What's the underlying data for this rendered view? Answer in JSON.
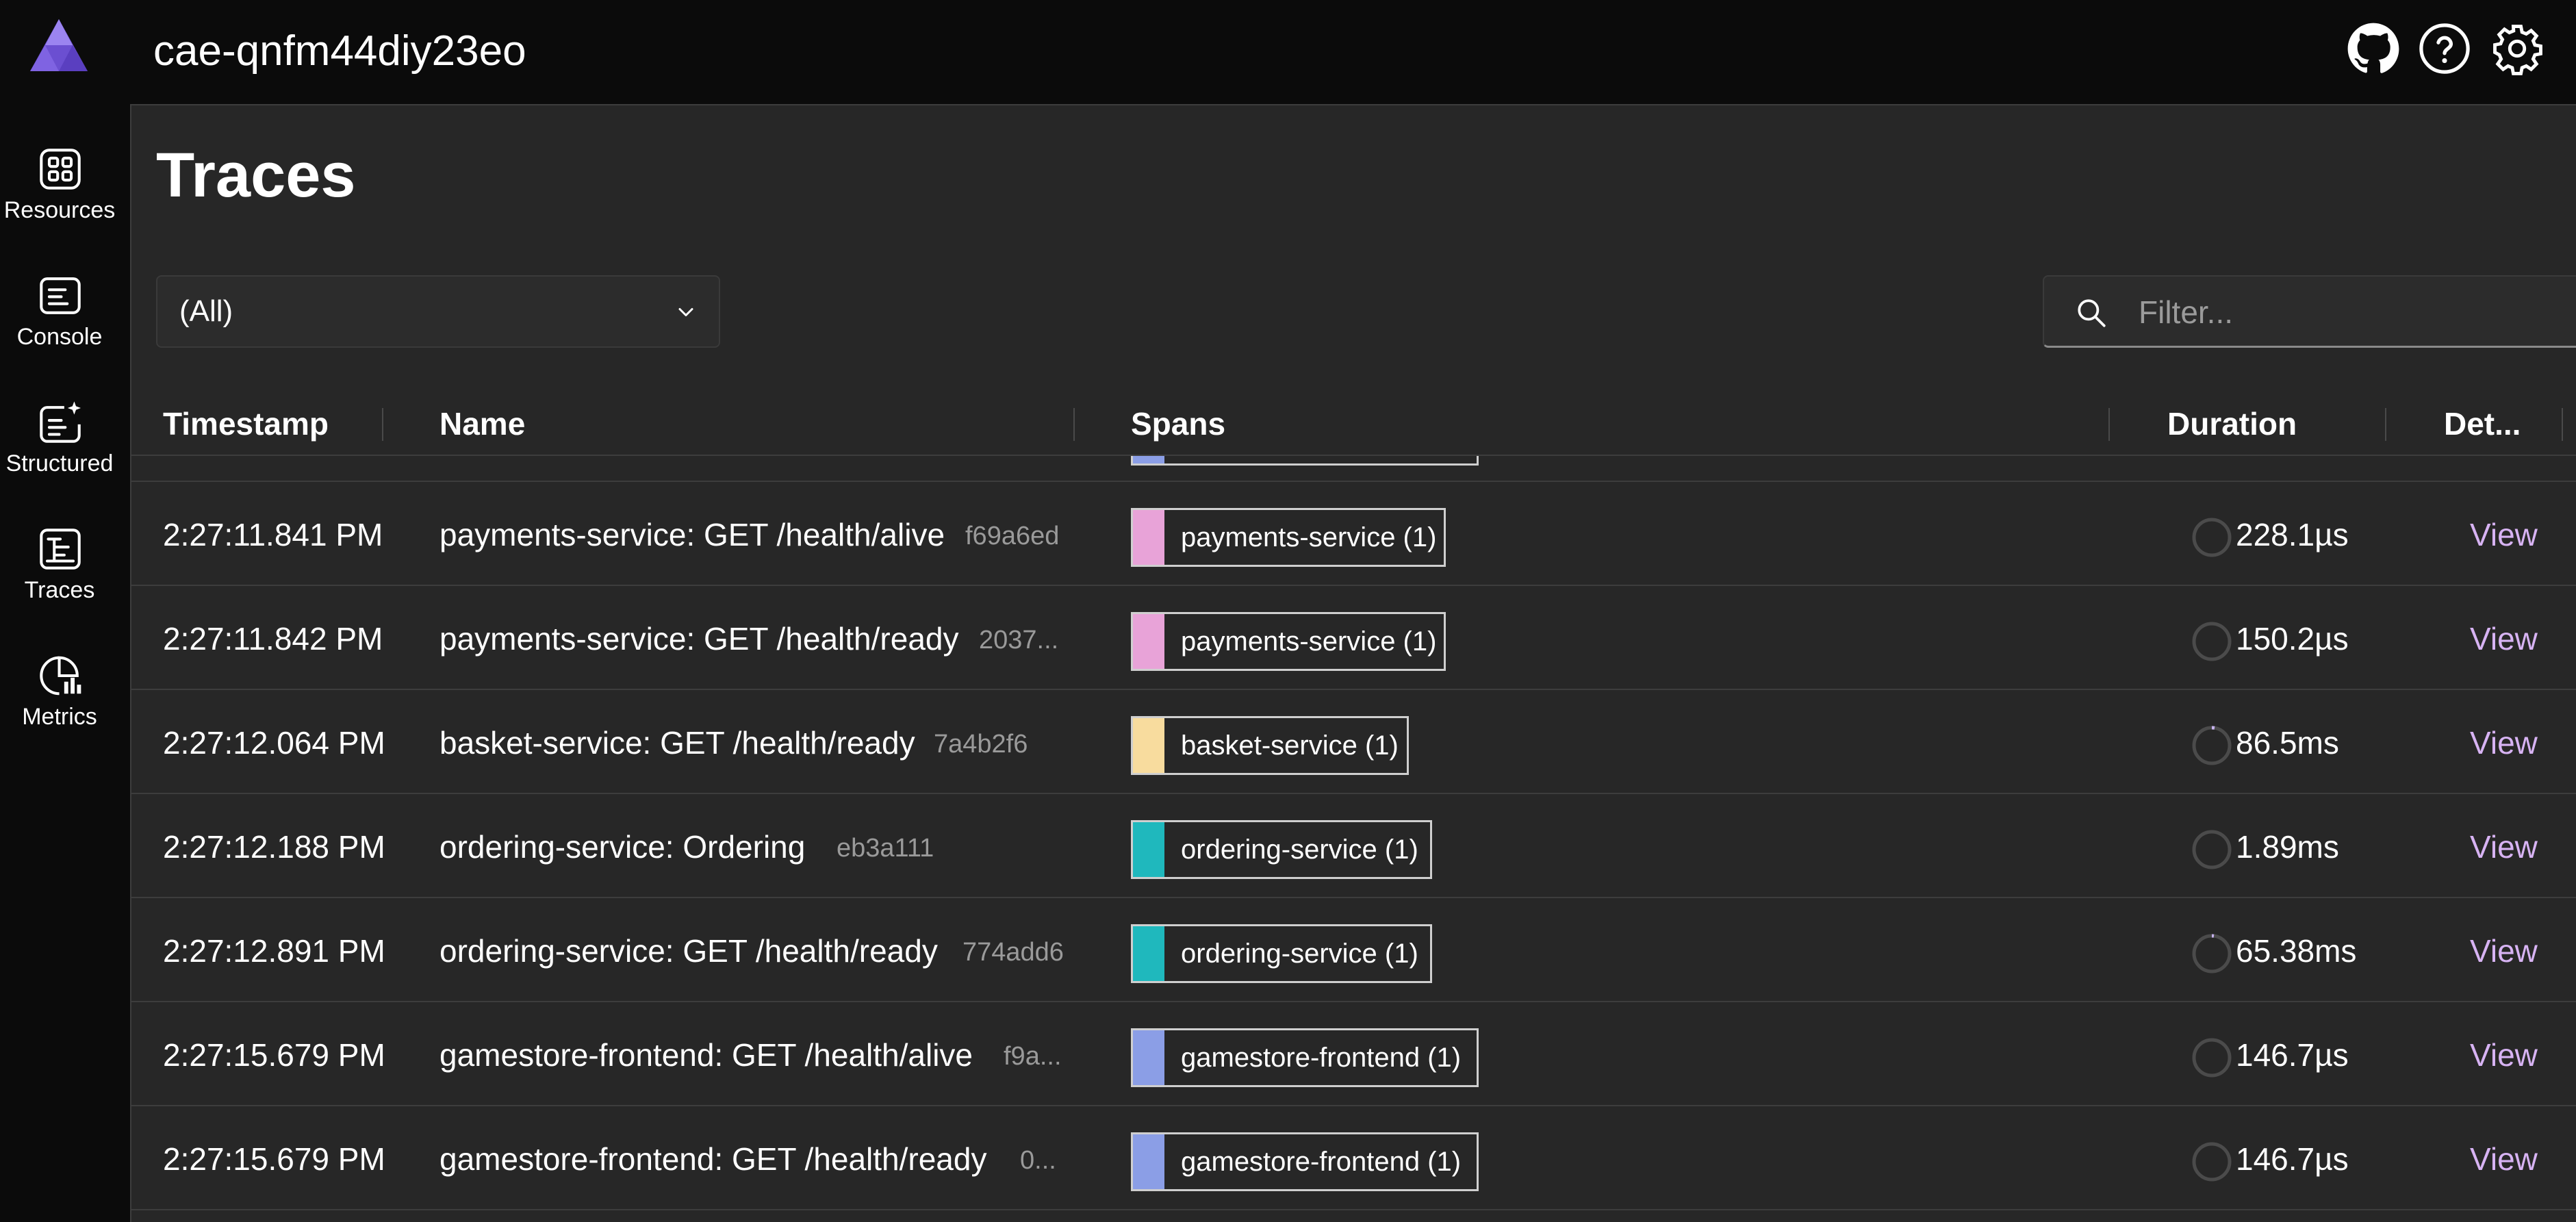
{
  "app": {
    "title": "cae-qnfm44diy23eo"
  },
  "topbar": {
    "icons": [
      "github-icon",
      "help-icon",
      "settings-icon"
    ]
  },
  "nav": {
    "items": [
      {
        "label": "Resources",
        "icon": "resources-grid-icon"
      },
      {
        "label": "Console",
        "icon": "console-icon"
      },
      {
        "label": "Structured",
        "icon": "structured-logs-icon"
      },
      {
        "label": "Traces",
        "icon": "traces-icon"
      },
      {
        "label": "Metrics",
        "icon": "metrics-icon"
      }
    ]
  },
  "page": {
    "title": "Traces"
  },
  "resource_select": {
    "value": "(All)"
  },
  "filter": {
    "placeholder": "Filter..."
  },
  "table": {
    "headers": {
      "timestamp": "Timestamp",
      "name": "Name",
      "spans": "Spans",
      "duration": "Duration",
      "details": "Det..."
    },
    "rows": [
      {
        "timestamp": "2:27:11.841 PM",
        "name": "payments-service: GET /health/alive",
        "trace_id": "f69a6ed",
        "span": "payments-service (1)",
        "color": "#e8a3d8",
        "duration": "228.1µs",
        "view": "View"
      },
      {
        "timestamp": "2:27:11.842 PM",
        "name": "payments-service: GET /health/ready",
        "trace_id": "2037...",
        "span": "payments-service (1)",
        "color": "#e8a3d8",
        "duration": "150.2µs",
        "view": "View"
      },
      {
        "timestamp": "2:27:12.064 PM",
        "name": "basket-service: GET /health/ready",
        "trace_id": "7a4b2f6",
        "span": "basket-service (1)",
        "color": "#f8dc9e",
        "duration": "86.5ms",
        "view": "View"
      },
      {
        "timestamp": "2:27:12.188 PM",
        "name": "ordering-service: Ordering",
        "trace_id": "eb3a111",
        "span": "ordering-service (1)",
        "color": "#1fb8bd",
        "duration": "1.89ms",
        "view": "View"
      },
      {
        "timestamp": "2:27:12.891 PM",
        "name": "ordering-service: GET /health/ready",
        "trace_id": "774add6",
        "span": "ordering-service (1)",
        "color": "#1fb8bd",
        "duration": "65.38ms",
        "view": "View"
      },
      {
        "timestamp": "2:27:15.679 PM",
        "name": "gamestore-frontend: GET /health/alive",
        "trace_id": "f9a...",
        "span": "gamestore-frontend (1)",
        "color": "#8b9ee6",
        "duration": "146.7µs",
        "view": "View"
      },
      {
        "timestamp": "2:27:15.679 PM",
        "name": "gamestore-frontend: GET /health/ready",
        "trace_id": "0...",
        "span": "gamestore-frontend (1)",
        "color": "#8b9ee6",
        "duration": "146.7µs",
        "view": "View"
      }
    ]
  }
}
